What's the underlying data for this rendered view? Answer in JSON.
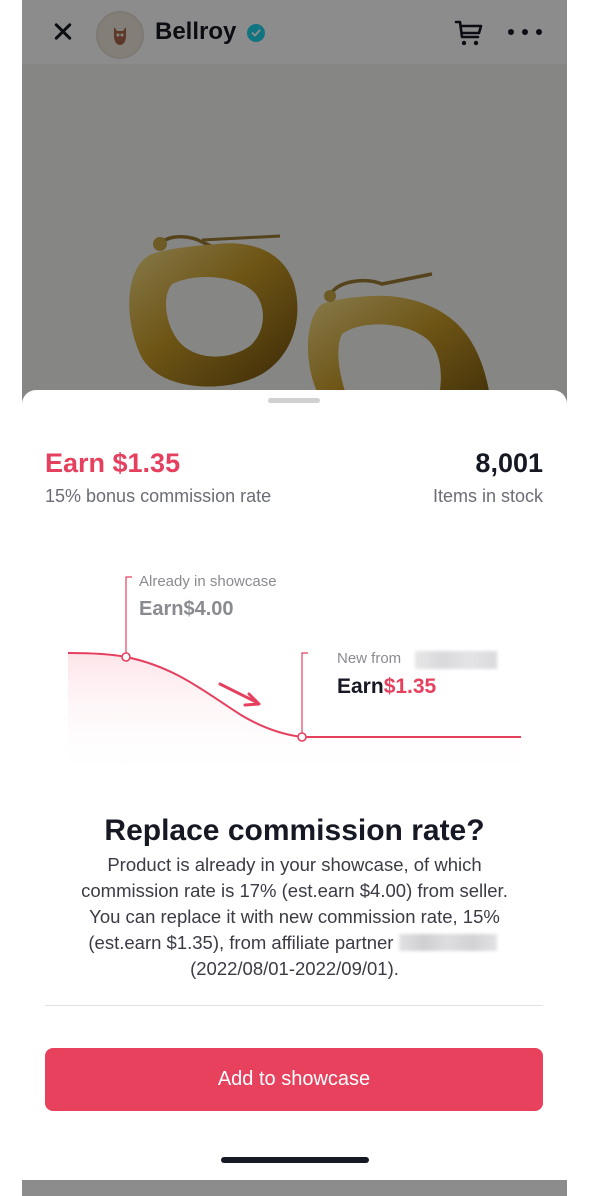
{
  "header": {
    "shop_name": "Bellroy",
    "close_icon": "close-icon",
    "cart_icon": "cart-icon",
    "more_icon": "more-icon",
    "verified_icon": "verified-badge-icon"
  },
  "sheet": {
    "earn_title": "Earn $1.35",
    "earn_subtitle": "15% bonus commission rate",
    "stock_value": "8,001",
    "stock_label": "Items in stock",
    "chart": {
      "already_label": "Already in showcase",
      "already_earn": "Earn$4.00",
      "new_label": "New from",
      "new_earn_prefix": "Earn",
      "new_earn_value": "$1.35"
    },
    "dialog_title": "Replace commission rate?",
    "dialog_body_main": "Product is already in your showcase, of which commission rate is 17% (est.earn $4.00) from seller. You can replace it with new commission rate, 15% (est.earn $1.35), from affiliate partner",
    "dialog_body_period": "(2022/08/01-2022/09/01).",
    "cta_label": "Add to showcase"
  },
  "colors": {
    "accent": "#e8415d",
    "earn_text": "#e5405e",
    "verified": "#20d5ec"
  }
}
